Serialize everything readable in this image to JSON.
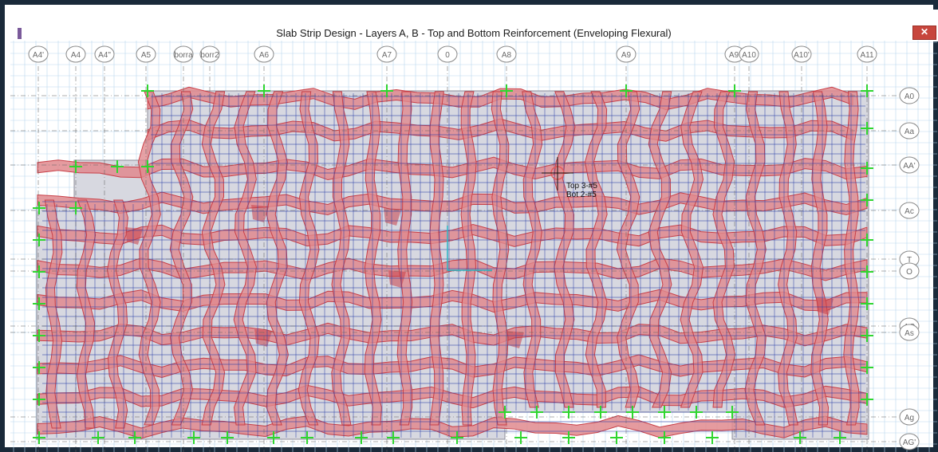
{
  "window": {
    "title": "Slab Strip Design - Layers A, B - Top and Bottom Reinforcement (Enveloping Flexural)",
    "close_label": "✕"
  },
  "grid": {
    "x_labels": [
      "A4'",
      "A4",
      "A4\"",
      "A5",
      "borra",
      "borr2",
      "A6",
      "A7",
      "0",
      "A8",
      "A9",
      "A9'",
      "A10",
      "A10'",
      "A11"
    ],
    "y_labels": [
      "A0",
      "Aa",
      "AA'",
      "Ac",
      "T",
      "O",
      "AC",
      "As",
      "Ag",
      "AG'"
    ]
  },
  "tooltip": {
    "top": "Top 3-#5",
    "bottom": "Bot 2-#5"
  },
  "colors": {
    "slab": "#d7d8e0",
    "strip": "#c84048",
    "strip_fill": "#e08a8e",
    "mesh": "#2b3fa8",
    "grid_light": "#b9d7ef",
    "support": "#2fd62f",
    "bubble": "#8a8a8a"
  }
}
